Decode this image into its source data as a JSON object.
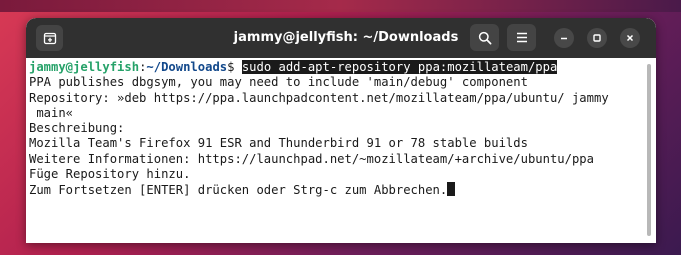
{
  "window": {
    "title": "jammy@jellyfish: ~/Downloads"
  },
  "titlebar": {
    "new_tab_icon": "new-tab-icon",
    "search_icon": "search-icon",
    "menu_icon": "hamburger-menu-icon",
    "minimize_icon": "minimize-icon",
    "maximize_icon": "maximize-icon",
    "close_icon": "close-icon"
  },
  "terminal": {
    "prompt_user": "jammy@jellyfish",
    "prompt_colon": ":",
    "prompt_path": "~/Downloads",
    "prompt_symbol": "$ ",
    "command": "sudo add-apt-repository ppa:mozillateam/ppa",
    "output": [
      "PPA publishes dbgsym, you may need to include 'main/debug' component",
      "Repository: »deb https://ppa.launchpadcontent.net/mozillateam/ppa/ubuntu/ jammy",
      " main«",
      "Beschreibung:",
      "Mozilla Team's Firefox 91 ESR and Thunderbird 91 or 78 stable builds",
      "Weitere Informationen: https://launchpad.net/~mozillateam/+archive/ubuntu/ppa",
      "Füge Repository hinzu.",
      "Zum Fortsetzen [ENTER] drücken oder Strg-c zum Abbrechen."
    ]
  },
  "colors": {
    "titlebar": "#303030",
    "prompt_user": "#26a269",
    "prompt_path": "#12488b",
    "terminal_bg": "#ffffff",
    "terminal_fg": "#1a1a1a"
  }
}
